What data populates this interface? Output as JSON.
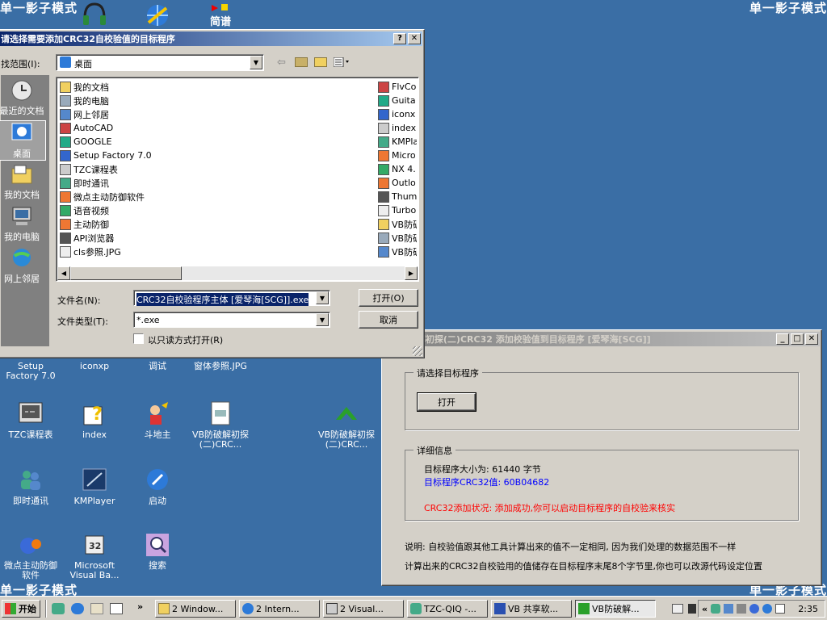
{
  "desktop": {
    "watermark": "单一影子模式",
    "icons": [
      {
        "label": "Setup\nFactory 7.0",
        "icon": "setup-icon"
      },
      {
        "label": "iconxp",
        "icon": "iconxp-icon"
      },
      {
        "label": "调试",
        "icon": "debug-icon"
      },
      {
        "label": "窗体参照.JPG",
        "icon": "image-icon"
      },
      {
        "label": "TZC课程表",
        "icon": "app-icon"
      },
      {
        "label": "index",
        "icon": "help-icon"
      },
      {
        "label": "斗地主",
        "icon": "game-icon"
      },
      {
        "label": "VB防破解初探\n(二)CRC...",
        "icon": "doc-icon"
      },
      {
        "label": "VB防破解初探\n(二)CRC...",
        "icon": "vb-icon"
      },
      {
        "label": "即时通讯",
        "icon": "chat-icon"
      },
      {
        "label": "KMPlayer",
        "icon": "kmplayer-icon"
      },
      {
        "label": "启动",
        "icon": "start-app-icon"
      },
      {
        "label": "微点主动防御\n软件",
        "icon": "shield-icon"
      },
      {
        "label": "Microsoft\nVisual Ba...",
        "icon": "vb6-icon"
      },
      {
        "label": "搜索",
        "icon": "search-icon"
      }
    ],
    "top_icons": [
      "headset-icon",
      "globe-icon",
      "music-icon"
    ],
    "top_icon_text": "简谱"
  },
  "open_dialog": {
    "title": "请选择需要添加CRC32自校验值的目标程序",
    "help_btn": "?",
    "close_btn": "✕",
    "lookin_label": "找范围(I):",
    "lookin_value": "桌面",
    "places": [
      "最近的文档",
      "桌面",
      "我的文档",
      "我的电脑",
      "网上邻居"
    ],
    "files_col1": [
      "我的文档",
      "我的电脑",
      "网上邻居",
      "AutoCAD",
      "GOOGLE",
      "Setup Factory 7.0",
      "TZC课程表",
      "即时通讯",
      "微点主动防御软件",
      "语音视频",
      "主动防御",
      "API浏览器",
      "cls参照.JPG"
    ],
    "files_col2": [
      "FlvCo",
      "Guita",
      "iconx",
      "index",
      "KMPla",
      "Micro",
      "NX 4.",
      "Outlo",
      "Thumb",
      "Turbo",
      "VB防破",
      "VB防破",
      "VB防破"
    ],
    "filename_label": "文件名(N):",
    "filename_value": "CRC32自校验程序主体 [爱琴海[SCG]].exe",
    "filetype_label": "文件类型(T):",
    "filetype_value": "*.exe",
    "readonly_label": "以只读方式打开(R)",
    "open_btn": "打开(O)",
    "cancel_btn": "取消"
  },
  "main_window": {
    "title": "VB防破解初探(二)CRC32 添加校验值到目标程序 [爱琴海[SCG]]",
    "group1_title": "请选择目标程序",
    "open_btn": "打开",
    "group2_title": "详细信息",
    "size_line": "目标程序大小为: 61440 字节",
    "crc_line": "目标程序CRC32值: 60B04682",
    "status_line": "CRC32添加状况: 添加成功,你可以启动目标程序的自校验来核实",
    "note1": "说明: 自校验值跟其他工具计算出来的值不一定相同, 因为我们处理的数据范围不一样",
    "note2": "计算出来的CRC32自校验用的值储存在目标程序末尾8个字节里,你也可以改源代码设定位置",
    "colors": {
      "crc": "#0000ff",
      "status": "#ff0000"
    }
  },
  "taskbar": {
    "start": "开始",
    "chevron": "»",
    "items": [
      "2 Window...",
      "2 Intern...",
      "2 Visual...",
      "TZC-QIQ -...",
      "VB 共享软...",
      "VB防破解..."
    ],
    "tray_chevron": "«",
    "clock": "2:35"
  }
}
